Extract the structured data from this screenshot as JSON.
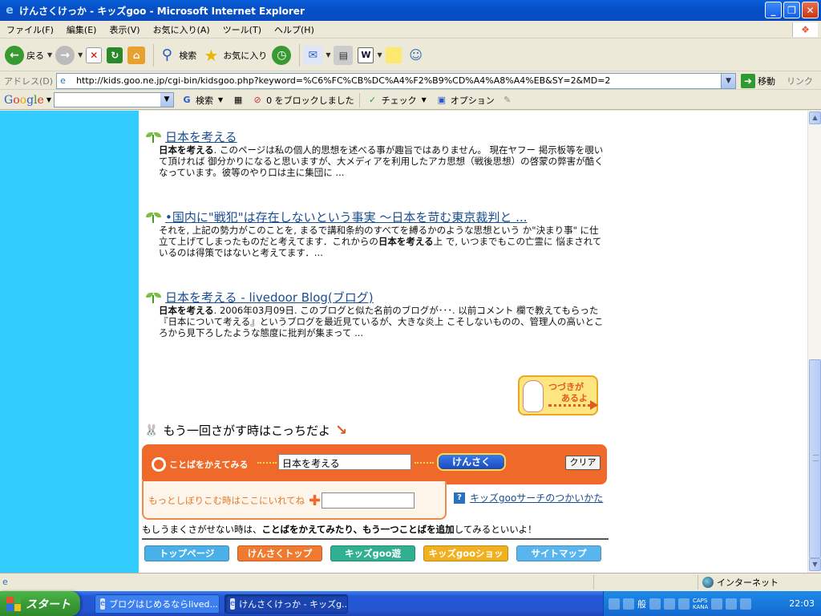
{
  "window": {
    "title": "けんさくけっか - キッズgoo - Microsoft Internet Explorer",
    "buttons": [
      "_",
      "❐",
      "✕"
    ]
  },
  "menu": [
    "ファイル(F)",
    "編集(E)",
    "表示(V)",
    "お気に入り(A)",
    "ツール(T)",
    "ヘルプ(H)"
  ],
  "toolbar": {
    "back_label": "戻る",
    "search_label": "検索",
    "favorites_label": "お気に入り"
  },
  "address": {
    "label": "アドレス(D)",
    "url": "http://kids.goo.ne.jp/cgi-bin/kidsgoo.php?keyword=%C6%FC%CB%DC%A4%F2%B9%CD%A4%A8%A4%EB&SY=2&MD=2",
    "go_label": "移動",
    "links_label": "リンク"
  },
  "google_toolbar": {
    "search_label": "検索",
    "popup_label": "0 をブロックしました",
    "check_label": "チェック",
    "options_label": "オプション"
  },
  "results": [
    {
      "title": "日本を考える",
      "snippet_bold": "日本を考える",
      "snippet": ". このページは私の個人的思想を述べる事が趣旨ではありません。 現在ヤフー 掲示板等を覗いて頂ければ 御分かりになると思いますが、大メディアを利用したアカ思想（戦後思想）の啓蒙の弊害が酷くなっています。彼等のやり口は主に集団に ..."
    },
    {
      "title": "•国内に\"戦犯\"は存在しないという事実 ～日本を苛む東京裁判と ...",
      "snippet_pre": "それを, 上記の勢力がこのことを, まるで講和条約のすべてを縛るかのような思想という か\"決まり事\" に仕立て上げてしまったものだと考えてます．これからの",
      "snippet_bold": "日本を考える",
      "snippet": "上 で, いつまでもこの亡霊に 悩まされているのは得策ではないと考えてます．..."
    },
    {
      "title": "日本を考える - livedoor Blog(ブログ)",
      "snippet_bold": "日本を考える",
      "snippet": ". 2006年03月09日. このブログと似た名前のブログが･･･. 以前コメント 欄で教えてもらった『日本について考える』というブログを最近見ているが、大きな炎上 こそしないものの、管理人の高いところから見下ろしたような態度に批判が集まって ..."
    }
  ],
  "more_badge": {
    "line1": "つづきが",
    "line2": "あるよ"
  },
  "search_again": "もう一回さがす時はこっちだよ",
  "search": {
    "label": "ことばをかえてみる",
    "keyword": "日本を考える",
    "submit_label": "けんさく",
    "clear_label": "クリア",
    "refine_label": "もっとしぼりこむ時はここにいれてね"
  },
  "howto_link": "キッズgooサーチのつかいかた",
  "hint": {
    "pre": "もしうまくさがせない時は、",
    "bold": "ことばをかえてみたり、もう一つことばを追加",
    "post": "してみるといいよ！"
  },
  "nav_buttons": [
    {
      "label": "トップページ",
      "color": "#4ab0e8"
    },
    {
      "label": "けんさくトップ",
      "color": "#ef7a30"
    },
    {
      "label": "キッズgoo遊",
      "color": "#30b090"
    },
    {
      "label": "キッズgooショップ",
      "color": "#f0b020"
    },
    {
      "label": "サイトマップ",
      "color": "#5ab4ee"
    }
  ],
  "status": {
    "zone": "インターネット"
  },
  "taskbar": {
    "start_label": "スタート",
    "tasks": [
      "ブログはじめるならlived...",
      "けんさくけっか - キッズg..."
    ],
    "clock": "22:03",
    "caps": "CAPS",
    "kana": "KANA",
    "ime": "般"
  }
}
